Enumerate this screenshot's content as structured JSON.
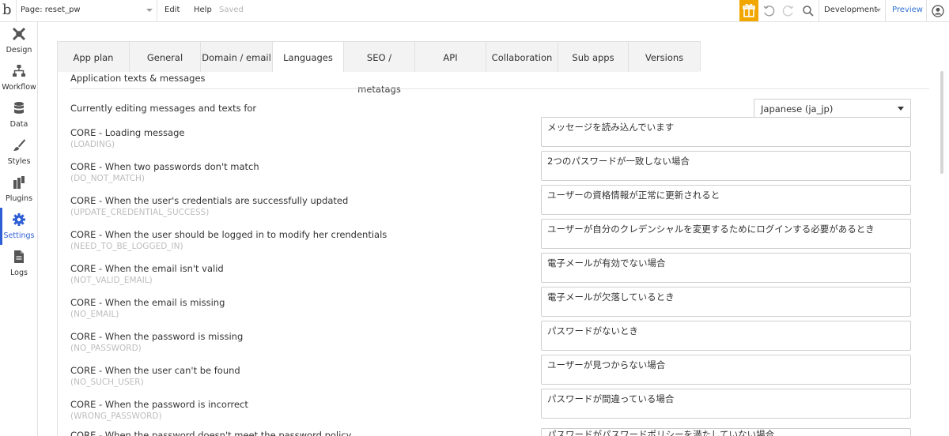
{
  "topbar": {
    "logo": "b",
    "page_label": "Page: reset_pw",
    "menu_edit": "Edit",
    "menu_help": "Help",
    "status": "Saved",
    "environment": "Development",
    "preview": "Preview"
  },
  "sidebar": {
    "items": [
      {
        "label": "Design"
      },
      {
        "label": "Workflow"
      },
      {
        "label": "Data"
      },
      {
        "label": "Styles"
      },
      {
        "label": "Plugins"
      },
      {
        "label": "Settings"
      },
      {
        "label": "Logs"
      }
    ]
  },
  "tabs": [
    {
      "label": "App plan"
    },
    {
      "label": "General"
    },
    {
      "label": "Domain / email"
    },
    {
      "label": "Languages"
    },
    {
      "label": "SEO / metatags"
    },
    {
      "label": "API"
    },
    {
      "label": "Collaboration"
    },
    {
      "label": "Sub apps"
    },
    {
      "label": "Versions"
    }
  ],
  "section": {
    "title": "Application texts & messages",
    "editing_label": "Currently editing messages and texts for",
    "language_value": "Japanese (ja_jp)"
  },
  "messages": [
    {
      "title": "CORE - Loading message",
      "key": "(LOADING)",
      "value": "メッセージを読み込んでいます"
    },
    {
      "title": "CORE - When two passwords don't match",
      "key": "(DO_NOT_MATCH)",
      "value": "2つのパスワードが一致しない場合"
    },
    {
      "title": "CORE - When the user's credentials are successfully updated",
      "key": "(UPDATE_CREDENTIAL_SUCCESS)",
      "value": "ユーザーの資格情報が正常に更新されると"
    },
    {
      "title": "CORE - When the user should be logged in to modify her crendentials",
      "key": "(NEED_TO_BE_LOGGED_IN)",
      "value": "ユーザーが自分のクレデンシャルを変更するためにログインする必要があるとき"
    },
    {
      "title": "CORE - When the email isn't valid",
      "key": "(NOT_VALID_EMAIL)",
      "value": "電子メールが有効でない場合"
    },
    {
      "title": "CORE - When the email is missing",
      "key": "(NO_EMAIL)",
      "value": "電子メールが欠落しているとき"
    },
    {
      "title": "CORE - When the password is missing",
      "key": "(NO_PASSWORD)",
      "value": "パスワードがないとき"
    },
    {
      "title": "CORE - When the user can't be found",
      "key": "(NO_SUCH_USER)",
      "value": "ユーザーが見つからない場合"
    },
    {
      "title": "CORE - When the password is incorrect",
      "key": "(WRONG_PASSWORD)",
      "value": "パスワードが間違っている場合"
    },
    {
      "title": "CORE - When the password doesn't meet the password policy",
      "key": "",
      "value": "パスワードがパスワードポリシーを満たしていない場合"
    }
  ],
  "colors": {
    "accent": "#2f5fd4",
    "gift": "#f2a600",
    "preview_link": "#2f72d6"
  }
}
